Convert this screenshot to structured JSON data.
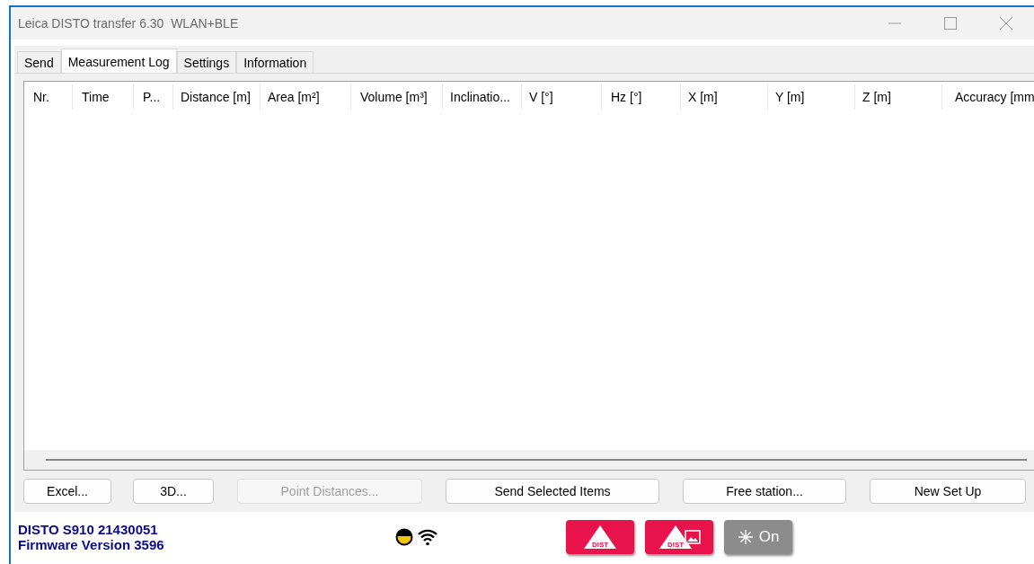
{
  "window": {
    "title": "Leica DISTO transfer 6.30  WLAN+BLE"
  },
  "tabs": [
    {
      "label": "Send",
      "selected": false
    },
    {
      "label": "Measurement Log",
      "selected": true
    },
    {
      "label": "Settings",
      "selected": false
    },
    {
      "label": "Information",
      "selected": false
    }
  ],
  "table": {
    "columns": [
      "Nr.",
      "Time",
      "P...",
      "Distance [m]",
      "Area [m²]",
      "Volume [m³]",
      "Inclinatio...",
      "V [°]",
      "Hz [°]",
      "X [m]",
      "Y [m]",
      "Z [m]",
      "Accuracy [mm"
    ]
  },
  "buttons": [
    {
      "label": "Excel...",
      "disabled": false
    },
    {
      "label": "3D...",
      "disabled": false
    },
    {
      "label": "Point Distances...",
      "disabled": true
    },
    {
      "label": "Send Selected Items",
      "disabled": false
    },
    {
      "label": "Free station...",
      "disabled": false
    },
    {
      "label": "New Set Up",
      "disabled": false
    }
  ],
  "status": {
    "device": "DISTO S910 21430051",
    "firmware": "Firmware Version 3596"
  },
  "actions": [
    {
      "kind": "dist",
      "label": "DIST"
    },
    {
      "kind": "dist-image",
      "label": "DIST"
    },
    {
      "kind": "laser",
      "label": "On"
    }
  ]
}
